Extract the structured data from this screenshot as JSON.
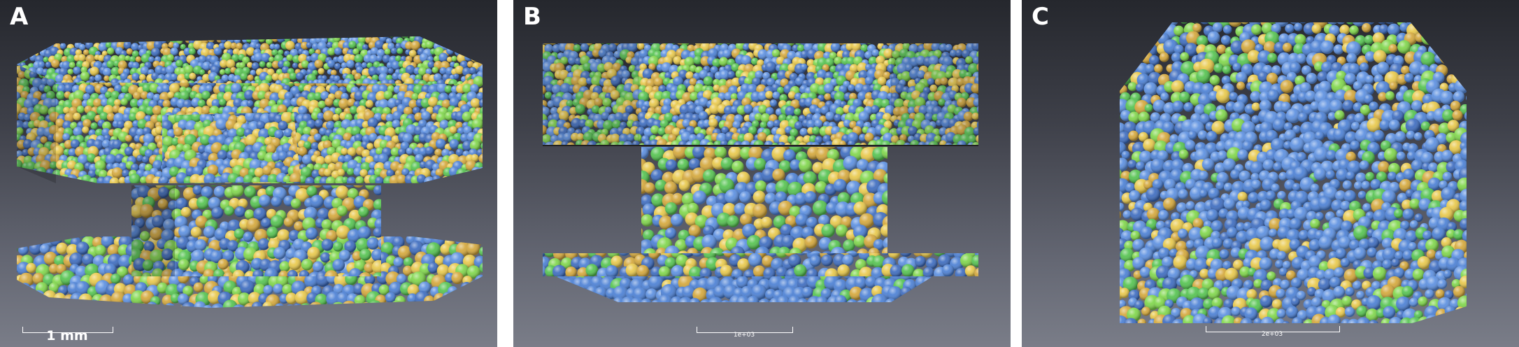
{
  "panels": [
    {
      "label": "A",
      "view": "perspective"
    },
    {
      "label": "B",
      "view": "side"
    },
    {
      "label": "C",
      "view": "top"
    }
  ],
  "scalebars": {
    "a": "1 mm",
    "b": "1e+03",
    "c": "2e+03"
  },
  "sphere_palette": [
    "#4a7fd4",
    "#5b8fe0",
    "#54c34f",
    "#7fd64a",
    "#e8c84a",
    "#d4a73a",
    "#3c6bbf"
  ],
  "background": {
    "top": "#25272d",
    "bottom": "#7a7d88"
  }
}
